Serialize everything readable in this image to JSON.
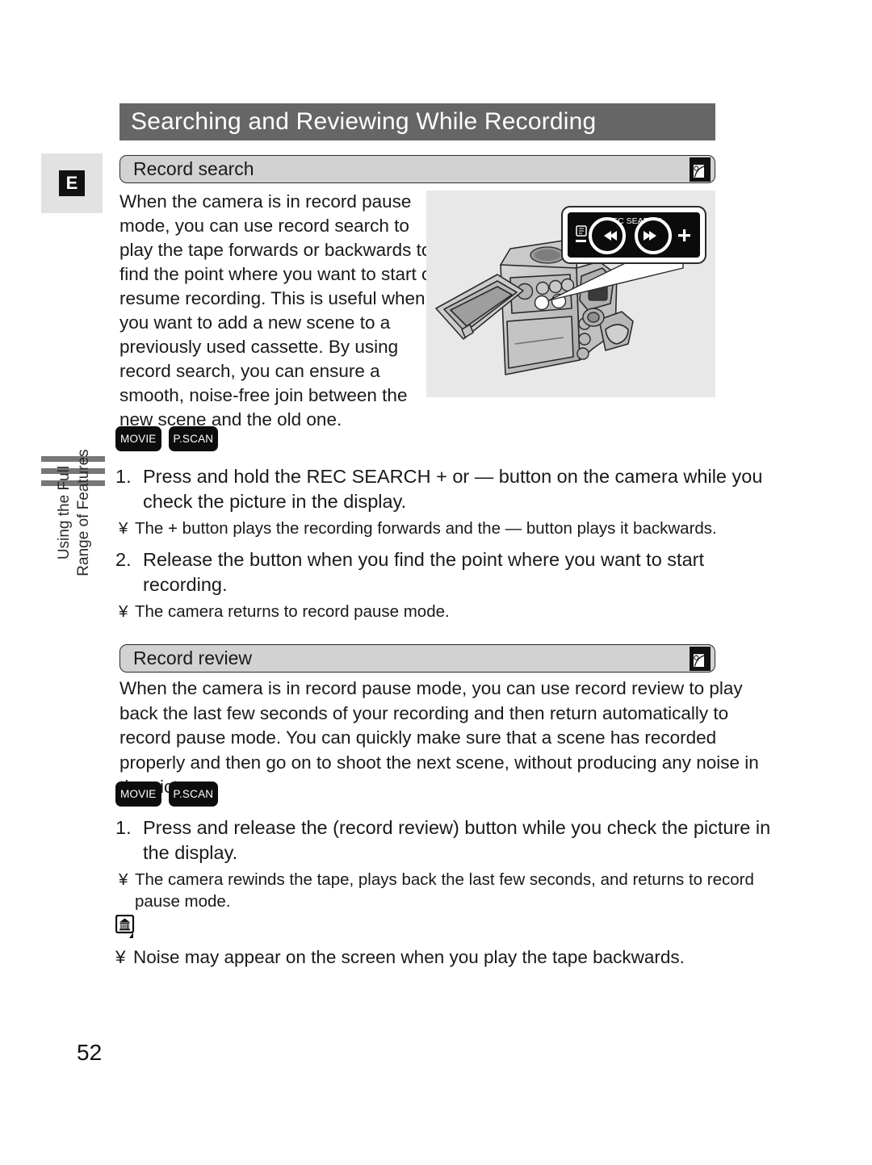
{
  "page": {
    "header_title": "Searching and Reviewing While Recording",
    "language_tab": "E",
    "page_number": "52",
    "side_label_line1": "Using the Full",
    "side_label_line2": "Range of Features"
  },
  "record_search": {
    "section_title": "Record search",
    "section_icon": "tape-icon",
    "intro": "When the camera is in record pause mode, you can use record search to play the tape forwards or backwards to find the point where you want to start or resume recording. This is useful when you want to add a new scene to a previously used cassette. By using record search, you can ensure a smooth, noise-free join between the new scene and the old one.",
    "badges": [
      "MOVIE",
      "P.SCAN"
    ],
    "steps": [
      {
        "number": "1.",
        "text": "Press and hold the REC SEARCH + or — button on the camera while you check the picture in the display.",
        "notes": [
          {
            "bullet": "¥",
            "text": "The + button plays the recording forwards and the — button plays it backwards."
          }
        ]
      },
      {
        "number": "2.",
        "text": "Release the button when you find the point where you want to start recording.",
        "notes": [
          {
            "bullet": "¥",
            "text": "The camera returns to record pause mode."
          }
        ]
      }
    ]
  },
  "illustration": {
    "callout_label": "REC SEARCH",
    "callout_minus": "—",
    "callout_plus": "+",
    "button_rewind": "◀◀",
    "button_forward": "▶▶",
    "review_icon": "record-review-icon"
  },
  "record_review": {
    "section_title": "Record review",
    "section_icon": "tape-icon",
    "intro": "When the camera is in record pause mode, you can use record review to play back the last few seconds of your recording and then return automatically to record pause mode. You can quickly make sure that a scene has recorded properly and then go on to shoot the next scene, without producing any noise in the picture.",
    "badges": [
      "MOVIE",
      "P.SCAN"
    ],
    "steps": [
      {
        "number": "1.",
        "text": "Press and release the  (record review) button while you check the picture in the display.",
        "notes": [
          {
            "bullet": "¥",
            "text": "The camera rewinds the tape, plays back the last few seconds, and returns to record pause mode."
          }
        ]
      }
    ]
  },
  "note": {
    "icon": "memo-note-icon",
    "bullet": "¥",
    "text": "Noise may appear on the screen when you play the tape backwards."
  }
}
